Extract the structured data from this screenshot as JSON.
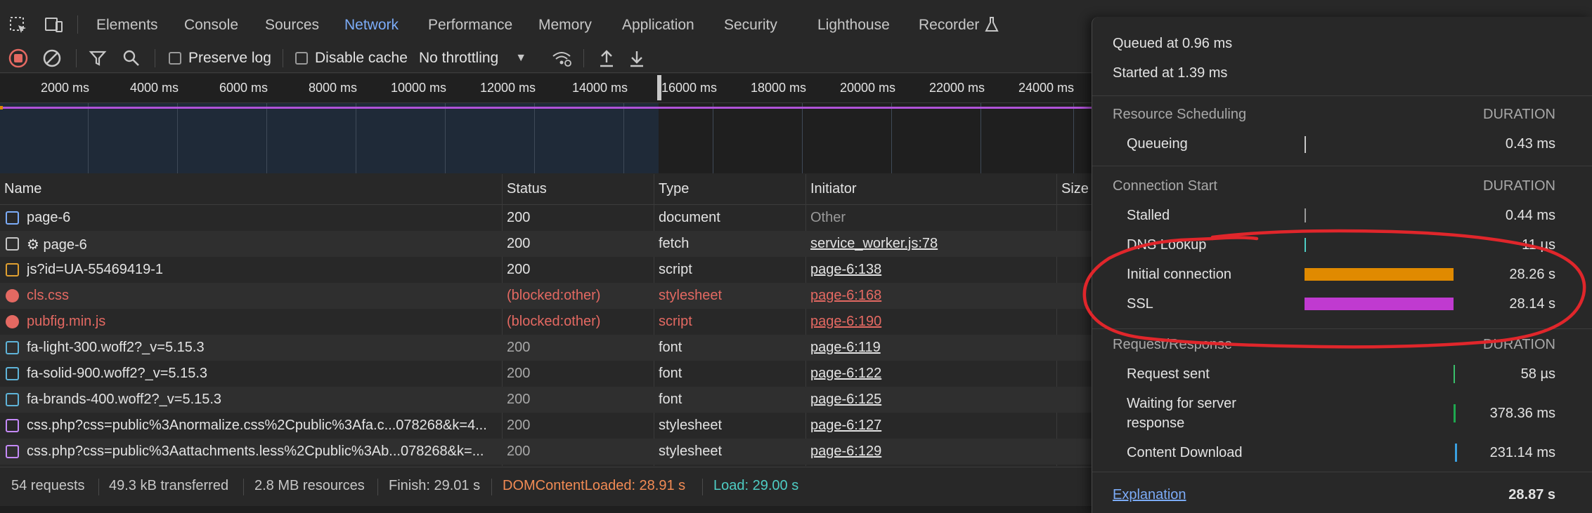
{
  "tabs": [
    "Elements",
    "Console",
    "Sources",
    "Network",
    "Performance",
    "Memory",
    "Application",
    "Security",
    "Lighthouse",
    "Recorder"
  ],
  "toolbar": {
    "preserve_log": "Preserve log",
    "disable_cache": "Disable cache",
    "throttling": "No throttling"
  },
  "timeline": {
    "ticks": [
      "2000 ms",
      "4000 ms",
      "6000 ms",
      "8000 ms",
      "10000 ms",
      "12000 ms",
      "14000 ms",
      "16000 ms",
      "18000 ms",
      "20000 ms",
      "22000 ms",
      "24000 ms"
    ]
  },
  "table": {
    "headers": {
      "name": "Name",
      "status": "Status",
      "type": "Type",
      "initiator": "Initiator",
      "size": "Size"
    },
    "rows": [
      {
        "name": "page-6",
        "status": "200",
        "type": "document",
        "initiator": "Other"
      },
      {
        "name": "⚙ page-6",
        "status": "200",
        "type": "fetch",
        "initiator": "service_worker.js:78"
      },
      {
        "name": "js?id=UA-55469419-1",
        "status": "200",
        "type": "script",
        "initiator": "page-6:138"
      },
      {
        "name": "cls.css",
        "status": "(blocked:other)",
        "type": "stylesheet",
        "initiator": "page-6:168"
      },
      {
        "name": "pubfig.min.js",
        "status": "(blocked:other)",
        "type": "script",
        "initiator": "page-6:190"
      },
      {
        "name": "fa-light-300.woff2?_v=5.15.3",
        "status": "200",
        "type": "font",
        "initiator": "page-6:119"
      },
      {
        "name": "fa-solid-900.woff2?_v=5.15.3",
        "status": "200",
        "type": "font",
        "initiator": "page-6:122"
      },
      {
        "name": "fa-brands-400.woff2?_v=5.15.3",
        "status": "200",
        "type": "font",
        "initiator": "page-6:125"
      },
      {
        "name": "css.php?css=public%3Anormalize.css%2Cpublic%3Afa.c...078268&k=4...",
        "status": "200",
        "type": "stylesheet",
        "initiator": "page-6:127"
      },
      {
        "name": "css.php?css=public%3Aattachments.less%2Cpublic%3Ab...078268&k=...",
        "status": "200",
        "type": "stylesheet",
        "initiator": "page-6:129"
      }
    ]
  },
  "statusbar": {
    "requests": "54 requests",
    "transferred": "49.3 kB transferred",
    "resources": "2.8 MB resources",
    "finish": "Finish: 29.01 s",
    "dcl": "DOMContentLoaded: 28.91 s",
    "load": "Load: 29.00 s"
  },
  "timing": {
    "queued": "Queued at 0.96 ms",
    "started": "Started at 1.39 ms",
    "duration_label": "DURATION",
    "resource_scheduling": "Resource Scheduling",
    "queueing": {
      "label": "Queueing",
      "value": "0.43 ms"
    },
    "connection_start": "Connection Start",
    "stalled": {
      "label": "Stalled",
      "value": "0.44 ms"
    },
    "dns": {
      "label": "DNS Lookup",
      "value": "11 µs"
    },
    "initial_connection": {
      "label": "Initial connection",
      "value": "28.26 s"
    },
    "ssl": {
      "label": "SSL",
      "value": "28.14 s"
    },
    "request_response": "Request/Response",
    "request_sent": {
      "label": "Request sent",
      "value": "58 µs"
    },
    "waiting_1": "Waiting for server",
    "waiting_2": "response",
    "waiting_value": "378.36 ms",
    "content_download": {
      "label": "Content Download",
      "value": "231.14 ms"
    },
    "explanation": "Explanation",
    "total": "28.87 s"
  },
  "colors": {
    "accent": "#7cacf8",
    "error": "#e46962",
    "initial_connection": "#e08a00",
    "ssl": "#c03ad0",
    "dcl": "#f28b54",
    "load": "#4ecdc4",
    "annotation": "#e0262b"
  }
}
